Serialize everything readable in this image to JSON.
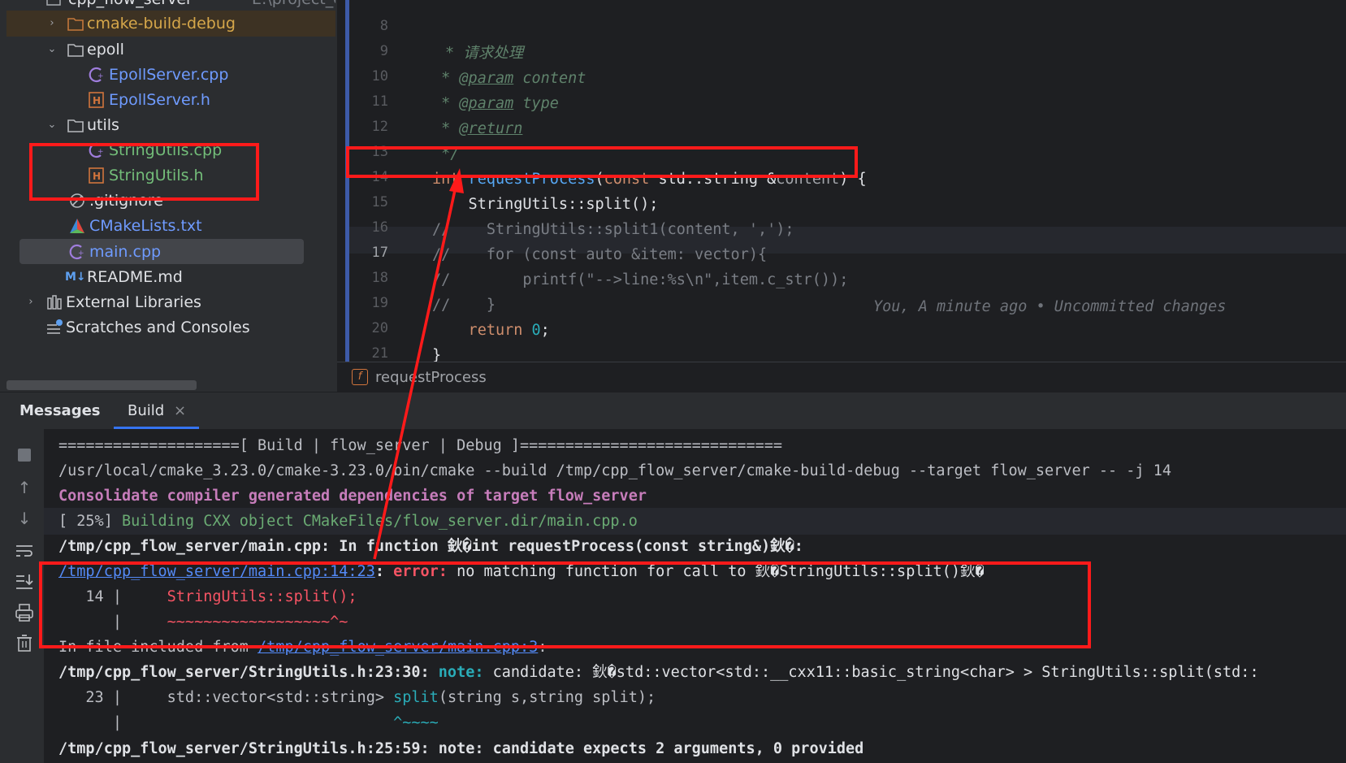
{
  "project_tree": {
    "root_label": "cpp_flow_server",
    "root_path": "E:\\project_cpp\\",
    "items": [
      {
        "label": "cmake-build-debug",
        "icon": "folder-icon"
      },
      {
        "label": "epoll",
        "icon": "folder-icon"
      },
      {
        "label": "EpollServer.cpp",
        "icon": "cpp-file-icon"
      },
      {
        "label": "EpollServer.h",
        "icon": "header-file-icon"
      },
      {
        "label": "utils",
        "icon": "folder-icon"
      },
      {
        "label": "StringUtils.cpp",
        "icon": "cpp-file-icon"
      },
      {
        "label": "StringUtils.h",
        "icon": "header-file-icon"
      },
      {
        "label": ".gitignore",
        "icon": "ignore-file-icon"
      },
      {
        "label": "CMakeLists.txt",
        "icon": "cmake-icon"
      },
      {
        "label": "main.cpp",
        "icon": "cpp-file-icon"
      },
      {
        "label": "README.md",
        "icon": "markdown-icon"
      },
      {
        "label": "External Libraries",
        "icon": "library-icon"
      },
      {
        "label": "Scratches and Consoles",
        "icon": "scratches-icon"
      }
    ]
  },
  "editor": {
    "line_numbers": [
      "8",
      "9",
      "10",
      "11",
      "12",
      "13",
      "14",
      "15",
      "16",
      "17",
      "18",
      "19",
      "20",
      "21"
    ],
    "lines": {
      "l8": "* 请求处理",
      "l9_star": " * ",
      "l9_tag": "@param",
      "l9_name": " content",
      "l10_star": " * ",
      "l10_tag": "@param",
      "l10_name": " type",
      "l11_star": " * ",
      "l11_tag": "@return",
      "l12": " */",
      "l13_type": "int",
      "l13_fn": " requestProcess",
      "l13_open": "(",
      "l13_const": "const",
      "l13_rest": " std::string &",
      "l13_param": "content",
      "l13_end": ") {",
      "l14": "    StringUtils::split();",
      "l15": "//    StringUtils::split1(content, ',');",
      "l16": "//    for (const auto &item: vector){",
      "l17": "//        printf(\"-->line:%s\\n\",item.c_str());",
      "l17_blame": "You, A minute ago • Uncommitted changes",
      "l18": "//    }",
      "l19_kw": "    return",
      "l19_num": " 0",
      "l19_end": ";",
      "l20": "}",
      "l21": "/**"
    },
    "breadcrumb": "requestProcess"
  },
  "panel": {
    "tabs": [
      "Messages",
      "Build"
    ],
    "active_tab": "Build"
  },
  "console": {
    "l1": "====================[ Build | flow_server | Debug ]=============================",
    "l2": "/usr/local/cmake_3.23.0/cmake-3.23.0/bin/cmake --build /tmp/cpp_flow_server/cmake-build-debug --target flow_server -- -j 14",
    "l3": "Consolidate compiler generated dependencies of target flow_server",
    "l4_pre": "[ 25%] ",
    "l4": "Building CXX object CMakeFiles/flow_server.dir/main.cpp.o",
    "l5": "/tmp/cpp_flow_server/main.cpp: In function 鈥�int requestProcess(const string&)鈥�:",
    "l6_link": "/tmp/cpp_flow_server/main.cpp:14:23",
    "l6_colon": ": ",
    "l6_err": "error:",
    "l6_msg": " no matching function for call to 鈥�StringUtils::split()鈥�",
    "l7_num": "   14 |     ",
    "l7_code": "StringUtils::split();",
    "l8_bar": "      |     ",
    "l8_caret": "~~~~~~~~~~~~~~~~~~^~",
    "l9_pre": "In file included from ",
    "l9_link": "/tmp/cpp_flow_server/main.cpp:3",
    "l9_post": ":",
    "l10_pre": "/tmp/cpp_flow_server/StringUtils.h:23:30: ",
    "l10_note": "note:",
    "l10_msg": " candidate: 鈥�std::vector<std::__cxx11::basic_string<char> > StringUtils::split(std::",
    "l11_pre": "   23 |     std::vector<std::string> ",
    "l11_fn": "split",
    "l11_post": "(string s,string split);",
    "l12_bar": "      |                              ",
    "l12_caret": "^~~~~",
    "l13": "/tmp/cpp_flow_server/StringUtils.h:25:59: note: candidate expects 2 arguments, 0 provided"
  },
  "colors": {
    "annotation_red": "#ff1a1a",
    "error": "#f75464",
    "link": "#548af7",
    "keyword": "#cf8e6d",
    "function": "#56a8f5",
    "accent_tab": "#3574f0"
  }
}
